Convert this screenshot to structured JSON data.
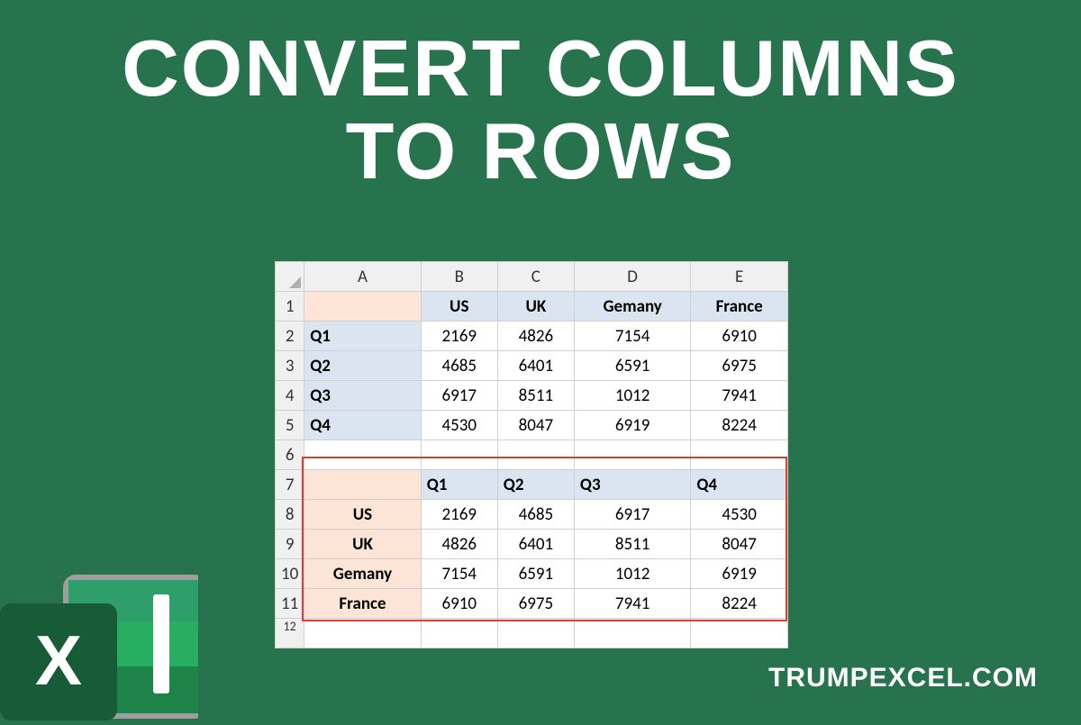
{
  "title_line1": "CONVERT COLUMNS",
  "title_line2": "TO ROWS",
  "footer": "TRUMPEXCEL.COM",
  "columns": [
    "A",
    "B",
    "C",
    "D",
    "E"
  ],
  "row_numbers": [
    "1",
    "2",
    "3",
    "4",
    "5",
    "6",
    "7",
    "8",
    "9",
    "10",
    "11",
    "12"
  ],
  "top_table": {
    "headers": [
      "US",
      "UK",
      "Gemany",
      "France"
    ],
    "row_labels": [
      "Q1",
      "Q2",
      "Q3",
      "Q4"
    ],
    "data": [
      [
        2169,
        4826,
        7154,
        6910
      ],
      [
        4685,
        6401,
        6591,
        6975
      ],
      [
        6917,
        8511,
        1012,
        7941
      ],
      [
        4530,
        8047,
        6919,
        8224
      ]
    ]
  },
  "bottom_table": {
    "headers": [
      "Q1",
      "Q2",
      "Q3",
      "Q4"
    ],
    "row_labels": [
      "US",
      "UK",
      "Gemany",
      "France"
    ],
    "data": [
      [
        2169,
        4685,
        6917,
        4530
      ],
      [
        4826,
        6401,
        8511,
        8047
      ],
      [
        7154,
        6591,
        1012,
        6919
      ],
      [
        6910,
        6975,
        7941,
        8224
      ]
    ]
  },
  "chart_data": {
    "type": "table",
    "title": "Convert Columns to Rows (Transpose example)",
    "original": {
      "columns": [
        "US",
        "UK",
        "Gemany",
        "France"
      ],
      "rows": [
        "Q1",
        "Q2",
        "Q3",
        "Q4"
      ],
      "values": [
        [
          2169,
          4826,
          7154,
          6910
        ],
        [
          4685,
          6401,
          6591,
          6975
        ],
        [
          6917,
          8511,
          1012,
          7941
        ],
        [
          4530,
          8047,
          6919,
          8224
        ]
      ]
    },
    "transposed": {
      "columns": [
        "Q1",
        "Q2",
        "Q3",
        "Q4"
      ],
      "rows": [
        "US",
        "UK",
        "Gemany",
        "France"
      ],
      "values": [
        [
          2169,
          4685,
          6917,
          4530
        ],
        [
          4826,
          6401,
          8511,
          8047
        ],
        [
          7154,
          6591,
          1012,
          6919
        ],
        [
          6910,
          6975,
          7941,
          8224
        ]
      ]
    }
  }
}
